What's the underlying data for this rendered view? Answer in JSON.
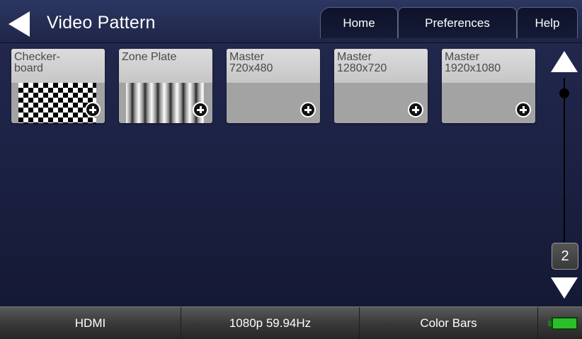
{
  "header": {
    "title": "Video Pattern",
    "back_icon": "back-arrow-icon",
    "tabs": [
      {
        "label": "Home"
      },
      {
        "label": "Preferences"
      },
      {
        "label": "Help"
      }
    ]
  },
  "tiles": [
    {
      "label": "Checker-\nboard",
      "pattern": "checkerboard",
      "action_icon": "add-icon"
    },
    {
      "label": "Zone Plate",
      "pattern": "zone-plate",
      "action_icon": "add-icon"
    },
    {
      "label": "Master\n720x480",
      "pattern": "none",
      "action_icon": "add-icon"
    },
    {
      "label": "Master\n1280x720",
      "pattern": "none",
      "action_icon": "add-icon"
    },
    {
      "label": "Master\n1920x1080",
      "pattern": "none",
      "action_icon": "add-icon"
    }
  ],
  "scroll": {
    "page_number": "2",
    "up_icon": "scroll-up-arrow-icon",
    "down_icon": "scroll-down-arrow-icon"
  },
  "status_bar": {
    "interface": "HDMI",
    "format": "1080p 59.94Hz",
    "pattern": "Color Bars",
    "battery_icon": "battery-icon",
    "battery_color": "#2bbf2b"
  },
  "colors": {
    "background": "#1c2244",
    "header": "#2c3762"
  }
}
